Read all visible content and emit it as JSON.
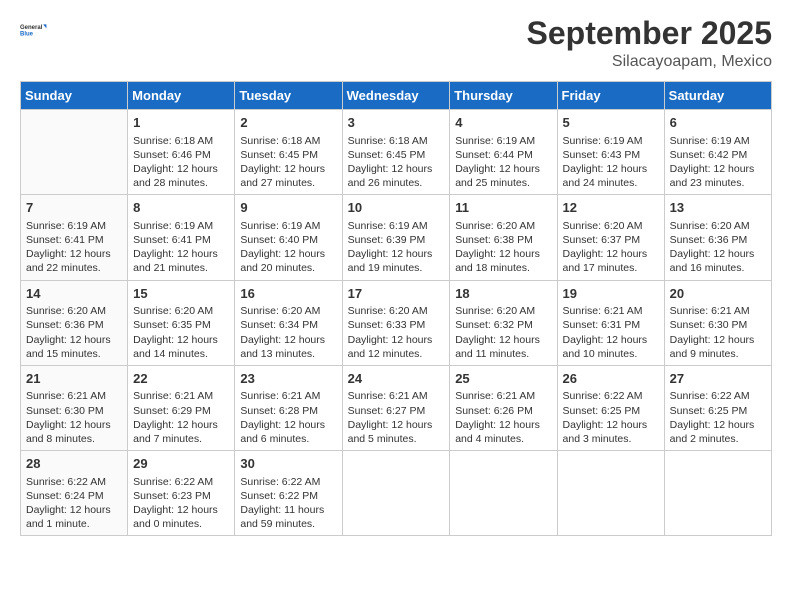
{
  "header": {
    "logo_general": "General",
    "logo_blue": "Blue",
    "month_title": "September 2025",
    "location": "Silacayoapam, Mexico"
  },
  "days_of_week": [
    "Sunday",
    "Monday",
    "Tuesday",
    "Wednesday",
    "Thursday",
    "Friday",
    "Saturday"
  ],
  "weeks": [
    [
      {
        "day": "",
        "info": ""
      },
      {
        "day": "1",
        "info": "Sunrise: 6:18 AM\nSunset: 6:46 PM\nDaylight: 12 hours and 28 minutes."
      },
      {
        "day": "2",
        "info": "Sunrise: 6:18 AM\nSunset: 6:45 PM\nDaylight: 12 hours and 27 minutes."
      },
      {
        "day": "3",
        "info": "Sunrise: 6:18 AM\nSunset: 6:45 PM\nDaylight: 12 hours and 26 minutes."
      },
      {
        "day": "4",
        "info": "Sunrise: 6:19 AM\nSunset: 6:44 PM\nDaylight: 12 hours and 25 minutes."
      },
      {
        "day": "5",
        "info": "Sunrise: 6:19 AM\nSunset: 6:43 PM\nDaylight: 12 hours and 24 minutes."
      },
      {
        "day": "6",
        "info": "Sunrise: 6:19 AM\nSunset: 6:42 PM\nDaylight: 12 hours and 23 minutes."
      }
    ],
    [
      {
        "day": "7",
        "info": "Sunrise: 6:19 AM\nSunset: 6:41 PM\nDaylight: 12 hours and 22 minutes."
      },
      {
        "day": "8",
        "info": "Sunrise: 6:19 AM\nSunset: 6:41 PM\nDaylight: 12 hours and 21 minutes."
      },
      {
        "day": "9",
        "info": "Sunrise: 6:19 AM\nSunset: 6:40 PM\nDaylight: 12 hours and 20 minutes."
      },
      {
        "day": "10",
        "info": "Sunrise: 6:19 AM\nSunset: 6:39 PM\nDaylight: 12 hours and 19 minutes."
      },
      {
        "day": "11",
        "info": "Sunrise: 6:20 AM\nSunset: 6:38 PM\nDaylight: 12 hours and 18 minutes."
      },
      {
        "day": "12",
        "info": "Sunrise: 6:20 AM\nSunset: 6:37 PM\nDaylight: 12 hours and 17 minutes."
      },
      {
        "day": "13",
        "info": "Sunrise: 6:20 AM\nSunset: 6:36 PM\nDaylight: 12 hours and 16 minutes."
      }
    ],
    [
      {
        "day": "14",
        "info": "Sunrise: 6:20 AM\nSunset: 6:36 PM\nDaylight: 12 hours and 15 minutes."
      },
      {
        "day": "15",
        "info": "Sunrise: 6:20 AM\nSunset: 6:35 PM\nDaylight: 12 hours and 14 minutes."
      },
      {
        "day": "16",
        "info": "Sunrise: 6:20 AM\nSunset: 6:34 PM\nDaylight: 12 hours and 13 minutes."
      },
      {
        "day": "17",
        "info": "Sunrise: 6:20 AM\nSunset: 6:33 PM\nDaylight: 12 hours and 12 minutes."
      },
      {
        "day": "18",
        "info": "Sunrise: 6:20 AM\nSunset: 6:32 PM\nDaylight: 12 hours and 11 minutes."
      },
      {
        "day": "19",
        "info": "Sunrise: 6:21 AM\nSunset: 6:31 PM\nDaylight: 12 hours and 10 minutes."
      },
      {
        "day": "20",
        "info": "Sunrise: 6:21 AM\nSunset: 6:30 PM\nDaylight: 12 hours and 9 minutes."
      }
    ],
    [
      {
        "day": "21",
        "info": "Sunrise: 6:21 AM\nSunset: 6:30 PM\nDaylight: 12 hours and 8 minutes."
      },
      {
        "day": "22",
        "info": "Sunrise: 6:21 AM\nSunset: 6:29 PM\nDaylight: 12 hours and 7 minutes."
      },
      {
        "day": "23",
        "info": "Sunrise: 6:21 AM\nSunset: 6:28 PM\nDaylight: 12 hours and 6 minutes."
      },
      {
        "day": "24",
        "info": "Sunrise: 6:21 AM\nSunset: 6:27 PM\nDaylight: 12 hours and 5 minutes."
      },
      {
        "day": "25",
        "info": "Sunrise: 6:21 AM\nSunset: 6:26 PM\nDaylight: 12 hours and 4 minutes."
      },
      {
        "day": "26",
        "info": "Sunrise: 6:22 AM\nSunset: 6:25 PM\nDaylight: 12 hours and 3 minutes."
      },
      {
        "day": "27",
        "info": "Sunrise: 6:22 AM\nSunset: 6:25 PM\nDaylight: 12 hours and 2 minutes."
      }
    ],
    [
      {
        "day": "28",
        "info": "Sunrise: 6:22 AM\nSunset: 6:24 PM\nDaylight: 12 hours and 1 minute."
      },
      {
        "day": "29",
        "info": "Sunrise: 6:22 AM\nSunset: 6:23 PM\nDaylight: 12 hours and 0 minutes."
      },
      {
        "day": "30",
        "info": "Sunrise: 6:22 AM\nSunset: 6:22 PM\nDaylight: 11 hours and 59 minutes."
      },
      {
        "day": "",
        "info": ""
      },
      {
        "day": "",
        "info": ""
      },
      {
        "day": "",
        "info": ""
      },
      {
        "day": "",
        "info": ""
      }
    ]
  ]
}
